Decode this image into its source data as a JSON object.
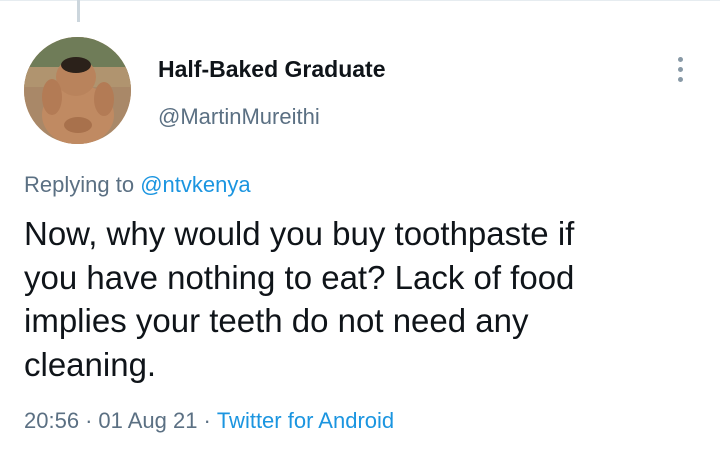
{
  "tweet": {
    "author": {
      "display_name": "Half-Baked Graduate",
      "handle": "@MartinMureithi"
    },
    "replying_prefix": "Replying to ",
    "replying_to": "@ntvkenya",
    "text": "Now, why would you buy toothpaste if\nyou have nothing to eat? Lack of food\nimplies your teeth do not need any\ncleaning.",
    "time": "20:56",
    "separator": "·",
    "date": "01 Aug 21",
    "source": "Twitter for Android"
  },
  "icons": {
    "more": "more-vertical-icon"
  },
  "colors": {
    "text_primary": "#0f1419",
    "text_secondary": "#5b7083",
    "link": "#1b95e0",
    "thread_line": "#ccd6dd"
  }
}
